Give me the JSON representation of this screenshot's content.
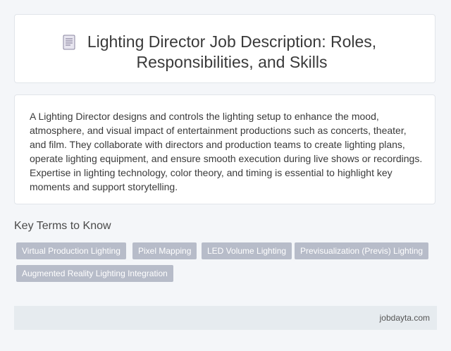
{
  "header": {
    "icon": "document-icon",
    "title": "Lighting Director Job Description: Roles, Responsibilities, and Skills"
  },
  "description": "A Lighting Director designs and controls the lighting setup to enhance the mood, atmosphere, and visual impact of entertainment productions such as concerts, theater, and film. They collaborate with directors and production teams to create lighting plans, operate lighting equipment, and ensure smooth execution during live shows or recordings. Expertise in lighting technology, color theory, and timing is essential to highlight key moments and support storytelling.",
  "key_terms": {
    "heading": "Key Terms to Know",
    "tags": [
      "Virtual Production Lighting",
      "Pixel Mapping",
      "LED Volume Lighting",
      "Previsualization (Previs) Lighting",
      "Augmented Reality Lighting Integration"
    ]
  },
  "footer": {
    "site": "jobdayta.com"
  },
  "colors": {
    "tag_background": "#b7bcc9",
    "page_background": "#f4f6f9",
    "footer_background": "#e6ebef"
  }
}
